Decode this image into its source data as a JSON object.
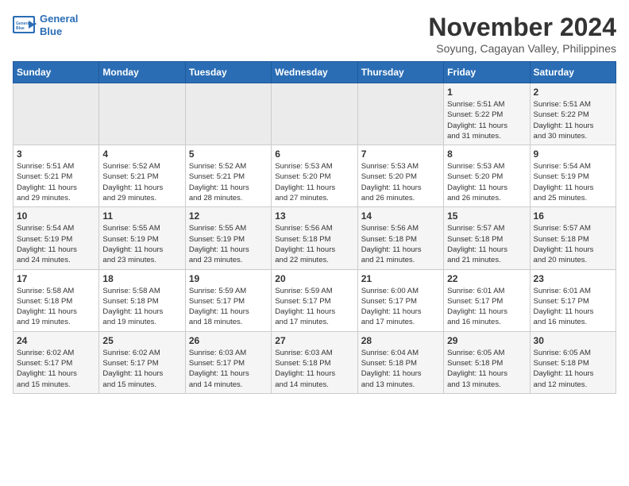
{
  "header": {
    "logo_line1": "General",
    "logo_line2": "Blue",
    "month": "November 2024",
    "location": "Soyung, Cagayan Valley, Philippines"
  },
  "weekdays": [
    "Sunday",
    "Monday",
    "Tuesday",
    "Wednesday",
    "Thursday",
    "Friday",
    "Saturday"
  ],
  "weeks": [
    [
      {
        "day": "",
        "info": ""
      },
      {
        "day": "",
        "info": ""
      },
      {
        "day": "",
        "info": ""
      },
      {
        "day": "",
        "info": ""
      },
      {
        "day": "",
        "info": ""
      },
      {
        "day": "1",
        "info": "Sunrise: 5:51 AM\nSunset: 5:22 PM\nDaylight: 11 hours\nand 31 minutes."
      },
      {
        "day": "2",
        "info": "Sunrise: 5:51 AM\nSunset: 5:22 PM\nDaylight: 11 hours\nand 30 minutes."
      }
    ],
    [
      {
        "day": "3",
        "info": "Sunrise: 5:51 AM\nSunset: 5:21 PM\nDaylight: 11 hours\nand 29 minutes."
      },
      {
        "day": "4",
        "info": "Sunrise: 5:52 AM\nSunset: 5:21 PM\nDaylight: 11 hours\nand 29 minutes."
      },
      {
        "day": "5",
        "info": "Sunrise: 5:52 AM\nSunset: 5:21 PM\nDaylight: 11 hours\nand 28 minutes."
      },
      {
        "day": "6",
        "info": "Sunrise: 5:53 AM\nSunset: 5:20 PM\nDaylight: 11 hours\nand 27 minutes."
      },
      {
        "day": "7",
        "info": "Sunrise: 5:53 AM\nSunset: 5:20 PM\nDaylight: 11 hours\nand 26 minutes."
      },
      {
        "day": "8",
        "info": "Sunrise: 5:53 AM\nSunset: 5:20 PM\nDaylight: 11 hours\nand 26 minutes."
      },
      {
        "day": "9",
        "info": "Sunrise: 5:54 AM\nSunset: 5:19 PM\nDaylight: 11 hours\nand 25 minutes."
      }
    ],
    [
      {
        "day": "10",
        "info": "Sunrise: 5:54 AM\nSunset: 5:19 PM\nDaylight: 11 hours\nand 24 minutes."
      },
      {
        "day": "11",
        "info": "Sunrise: 5:55 AM\nSunset: 5:19 PM\nDaylight: 11 hours\nand 23 minutes."
      },
      {
        "day": "12",
        "info": "Sunrise: 5:55 AM\nSunset: 5:19 PM\nDaylight: 11 hours\nand 23 minutes."
      },
      {
        "day": "13",
        "info": "Sunrise: 5:56 AM\nSunset: 5:18 PM\nDaylight: 11 hours\nand 22 minutes."
      },
      {
        "day": "14",
        "info": "Sunrise: 5:56 AM\nSunset: 5:18 PM\nDaylight: 11 hours\nand 21 minutes."
      },
      {
        "day": "15",
        "info": "Sunrise: 5:57 AM\nSunset: 5:18 PM\nDaylight: 11 hours\nand 21 minutes."
      },
      {
        "day": "16",
        "info": "Sunrise: 5:57 AM\nSunset: 5:18 PM\nDaylight: 11 hours\nand 20 minutes."
      }
    ],
    [
      {
        "day": "17",
        "info": "Sunrise: 5:58 AM\nSunset: 5:18 PM\nDaylight: 11 hours\nand 19 minutes."
      },
      {
        "day": "18",
        "info": "Sunrise: 5:58 AM\nSunset: 5:18 PM\nDaylight: 11 hours\nand 19 minutes."
      },
      {
        "day": "19",
        "info": "Sunrise: 5:59 AM\nSunset: 5:17 PM\nDaylight: 11 hours\nand 18 minutes."
      },
      {
        "day": "20",
        "info": "Sunrise: 5:59 AM\nSunset: 5:17 PM\nDaylight: 11 hours\nand 17 minutes."
      },
      {
        "day": "21",
        "info": "Sunrise: 6:00 AM\nSunset: 5:17 PM\nDaylight: 11 hours\nand 17 minutes."
      },
      {
        "day": "22",
        "info": "Sunrise: 6:01 AM\nSunset: 5:17 PM\nDaylight: 11 hours\nand 16 minutes."
      },
      {
        "day": "23",
        "info": "Sunrise: 6:01 AM\nSunset: 5:17 PM\nDaylight: 11 hours\nand 16 minutes."
      }
    ],
    [
      {
        "day": "24",
        "info": "Sunrise: 6:02 AM\nSunset: 5:17 PM\nDaylight: 11 hours\nand 15 minutes."
      },
      {
        "day": "25",
        "info": "Sunrise: 6:02 AM\nSunset: 5:17 PM\nDaylight: 11 hours\nand 15 minutes."
      },
      {
        "day": "26",
        "info": "Sunrise: 6:03 AM\nSunset: 5:17 PM\nDaylight: 11 hours\nand 14 minutes."
      },
      {
        "day": "27",
        "info": "Sunrise: 6:03 AM\nSunset: 5:18 PM\nDaylight: 11 hours\nand 14 minutes."
      },
      {
        "day": "28",
        "info": "Sunrise: 6:04 AM\nSunset: 5:18 PM\nDaylight: 11 hours\nand 13 minutes."
      },
      {
        "day": "29",
        "info": "Sunrise: 6:05 AM\nSunset: 5:18 PM\nDaylight: 11 hours\nand 13 minutes."
      },
      {
        "day": "30",
        "info": "Sunrise: 6:05 AM\nSunset: 5:18 PM\nDaylight: 11 hours\nand 12 minutes."
      }
    ]
  ]
}
